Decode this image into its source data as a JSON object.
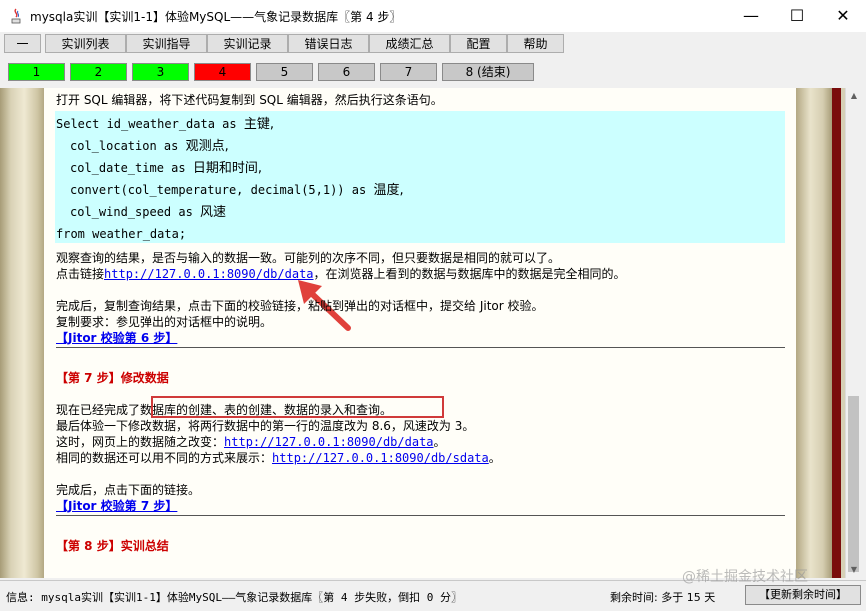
{
  "window": {
    "title": "mysqla实训【实训1-1】体验MySQL——气象记录数据库〖第 4 步〗",
    "minimize": "—",
    "maximize": "☐",
    "close": "✕"
  },
  "menu": {
    "items": [
      "一",
      "实训列表",
      "实训指导",
      "实训记录",
      "错误日志",
      "成绩汇总",
      "配置",
      "帮助"
    ]
  },
  "steps": {
    "items": [
      {
        "label": "1",
        "color": "#00ff00"
      },
      {
        "label": "2",
        "color": "#00ff00"
      },
      {
        "label": "3",
        "color": "#00ff00"
      },
      {
        "label": "4",
        "color": "#ff0000"
      },
      {
        "label": "5",
        "color": "#c8c8c8"
      },
      {
        "label": "6",
        "color": "#c8c8c8"
      },
      {
        "label": "7",
        "color": "#c8c8c8"
      },
      {
        "label": "8 (结束)",
        "color": "#c8c8c8"
      }
    ]
  },
  "content": {
    "intro": "打开 SQL 编辑器，将下述代码复制到 SQL 编辑器，然后执行这条语句。",
    "code": [
      {
        "kw": "Select id_weather_data as ",
        "cn": "主键,"
      },
      {
        "kw": "col_location as ",
        "cn": "观测点,"
      },
      {
        "kw": "col_date_time as ",
        "cn": "日期和时间,"
      },
      {
        "kw": "convert(col_temperature, decimal(5,1)) as ",
        "cn": "温度,"
      },
      {
        "kw": "col_wind_speed as ",
        "cn": "风速"
      },
      {
        "kw": "from weather_data;",
        "cn": ""
      }
    ],
    "observe": "观察查询的结果，是否与输入的数据一致。可能列的次序不同，但只要数据是相同的就可以了。",
    "click_prefix": "点击链接",
    "data_link": "http://127.0.0.1:8090/db/data",
    "click_suffix": "，在浏览器上看到的数据与数据库中的数据是完全相同的。",
    "complete": "完成后，复制查询结果，点击下面的校验链接，粘贴到弹出的对话框中，提交给 Jitor 校验。",
    "copy_req": "复制要求：参见弹出的对话框中的说明。",
    "verify6": "【Jitor 校验第 6 步】",
    "step7_title": "【第 7 步】修改数据",
    "step7_line1a": "现在已经完成了",
    "step7_line1b": "数据库的创建、表的创建、数据的录入和查询。",
    "step7_line2": "最后体验一下修改数据，将两行数据中的第一行的温度改为 8.6，风速改为 3。",
    "step7_line3_prefix": "这时，网页上的数据随之改变：",
    "step7_line3_link": "http://127.0.0.1:8090/db/data",
    "step7_line3_suffix": "。",
    "step7_line4_prefix": "相同的数据还可以用不同的方式来展示：",
    "step7_line4_link": "http://127.0.0.1:8090/db/sdata",
    "step7_line4_suffix": "。",
    "step7_complete": "完成后，点击下面的链接。",
    "verify7": "【Jitor 校验第 7 步】",
    "step8_title": "【第 8 步】实训总结"
  },
  "status": {
    "info": "信息: mysqla实训【实训1-1】体验MySQL——气象记录数据库〖第 4 步失败，倒扣 0 分〗",
    "remain": "剩余时间: 多于 15 天",
    "refresh": "【更新剩余时间】",
    "watermark": "@稀土掘金技术社区"
  }
}
